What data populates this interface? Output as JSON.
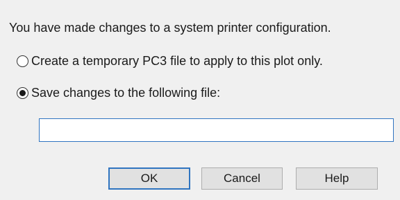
{
  "dialog": {
    "message": "You have made changes to a system printer configuration.",
    "options": [
      {
        "label": "Create a temporary PC3 file to apply to this plot only.",
        "selected": false
      },
      {
        "label": "Save changes to the following file:",
        "selected": true
      }
    ],
    "file_input": {
      "value": "",
      "placeholder": ""
    },
    "buttons": {
      "ok": "OK",
      "cancel": "Cancel",
      "help": "Help"
    }
  },
  "colors": {
    "background": "#f0f0f0",
    "accent": "#2f74c0",
    "button_face": "#e1e1e1",
    "button_border": "#adadad"
  }
}
